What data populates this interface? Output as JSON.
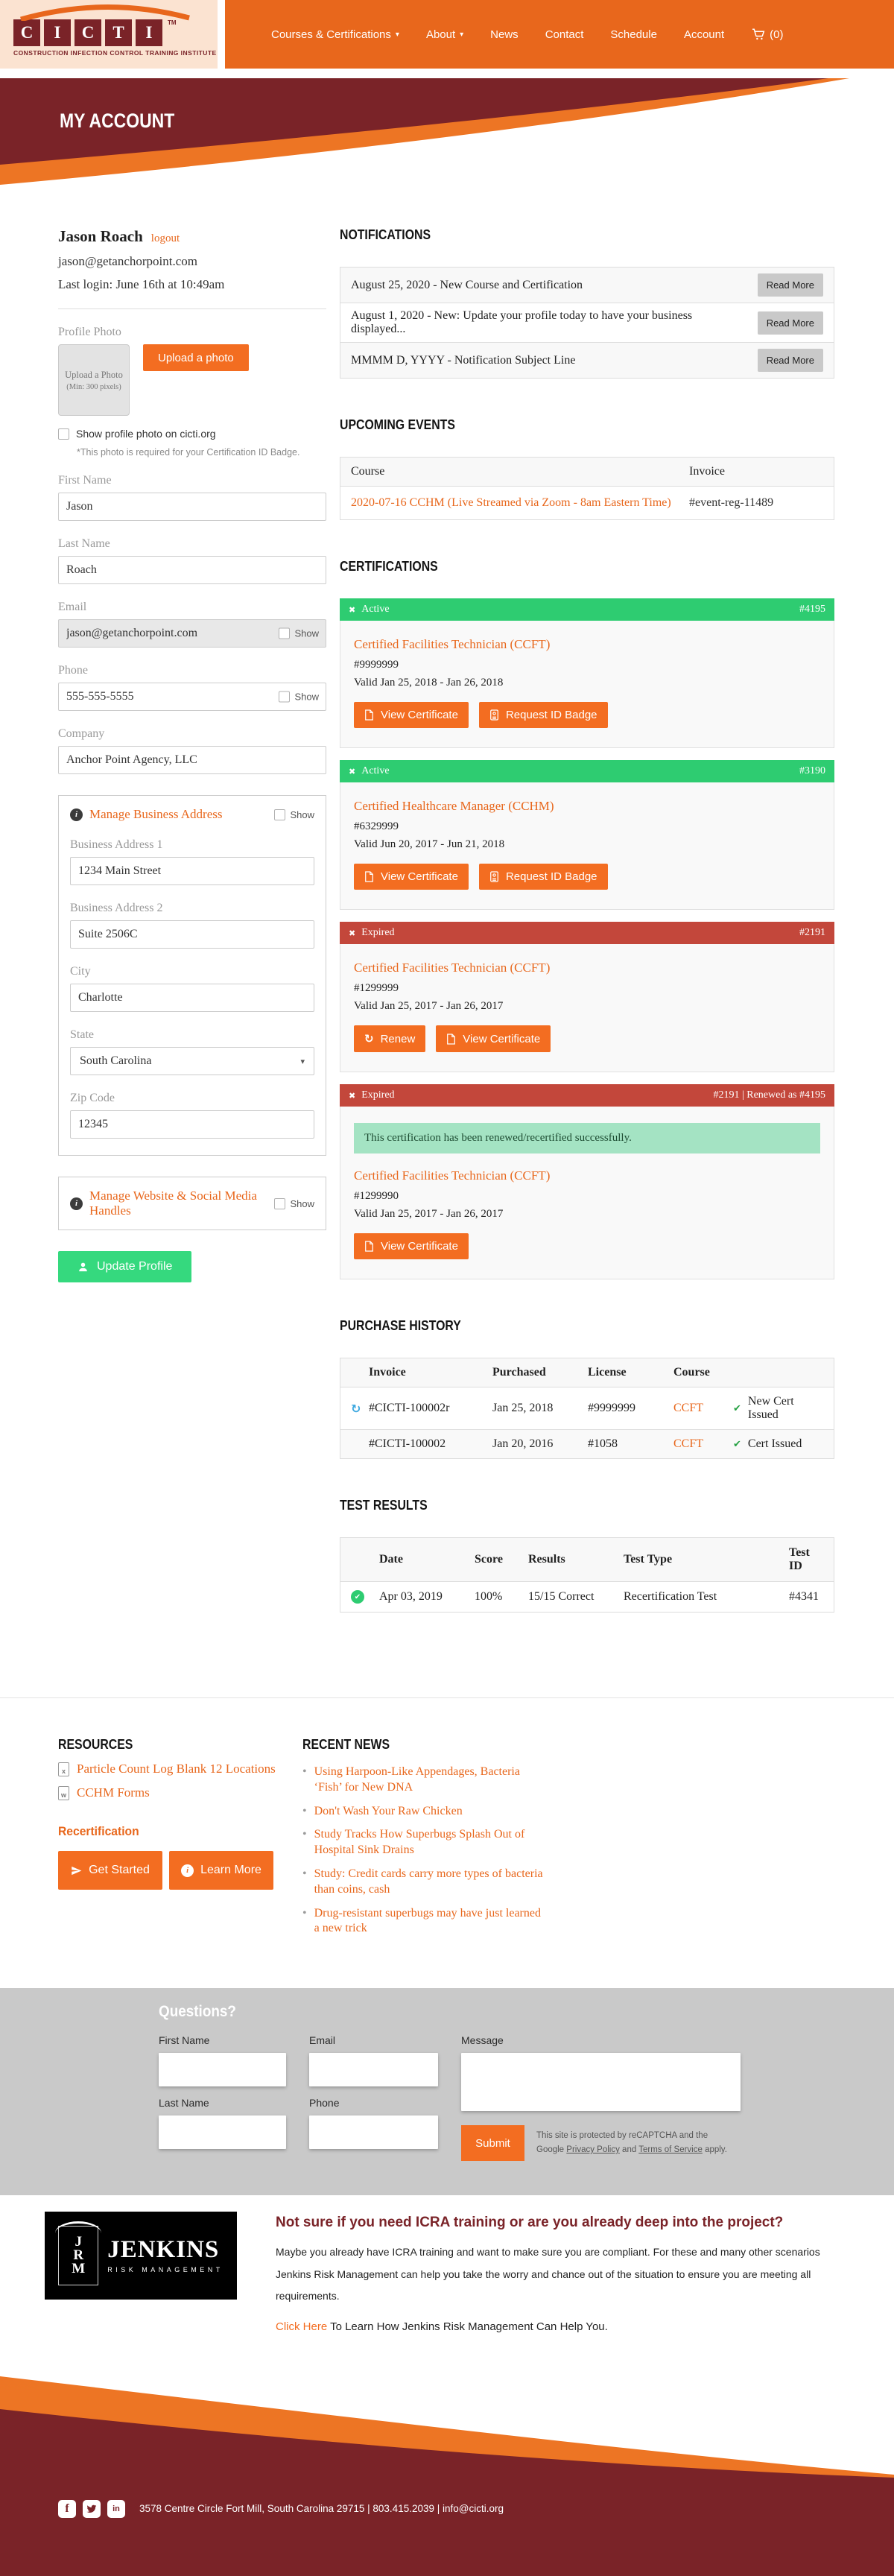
{
  "colors": {
    "orange": "#E8671C",
    "button_orange": "#F36D21",
    "maroon": "#7A2328",
    "green_active": "#2ECC71",
    "red_expired": "#C3473B",
    "update_green": "#35D97E",
    "gray_section": "#C9C9C9",
    "alert_green_bg": "#A4E3C3",
    "refresh_blue": "#3FA9E0"
  },
  "icons": {
    "chevron_down": "▾",
    "caret_down": "▾",
    "x_mark": "✖",
    "check": "✔",
    "refresh": "↻",
    "info": "i",
    "bullet": "•"
  },
  "header": {
    "logo": {
      "letters": [
        "C",
        "I",
        "C",
        "T",
        "I"
      ],
      "tm": "TM",
      "tagline": "CONSTRUCTION INFECTION CONTROL TRAINING INSTITUTE"
    },
    "nav": [
      {
        "label": "Courses & Certifications"
      },
      {
        "label": "About"
      },
      {
        "label": "News"
      },
      {
        "label": "Contact"
      },
      {
        "label": "Schedule"
      },
      {
        "label": "Account"
      },
      {
        "label": "(0)"
      }
    ]
  },
  "banner": {
    "title": "MY ACCOUNT"
  },
  "profile": {
    "name": "Jason Roach",
    "logout": "logout",
    "email": "jason@getanchorpoint.com",
    "last_login": "Last login: June 16th at 10:49am",
    "photo": {
      "label": "Profile Photo",
      "box_title": "Upload a Photo",
      "box_sub": "(Min: 300 pixels)",
      "upload_button": "Upload a photo",
      "show_label": "Show profile photo on cicti.org",
      "note": "*This photo is required for your Certification ID Badge."
    },
    "fields": {
      "first_name": {
        "label": "First Name",
        "value": "Jason"
      },
      "last_name": {
        "label": "Last Name",
        "value": "Roach"
      },
      "email": {
        "label": "Email",
        "value": "jason@getanchorpoint.com",
        "show": "Show"
      },
      "phone": {
        "label": "Phone",
        "value": "555-555-5555",
        "show": "Show"
      },
      "company": {
        "label": "Company",
        "value": "Anchor Point Agency, LLC"
      }
    },
    "business": {
      "title": "Manage Business Address",
      "show": "Show",
      "fields": {
        "address1": {
          "label": "Business Address 1",
          "value": "1234 Main Street"
        },
        "address2": {
          "label": "Business Address 2",
          "value": "Suite 2506C"
        },
        "city": {
          "label": "City",
          "value": "Charlotte"
        },
        "state": {
          "label": "State",
          "value": "South Carolina"
        },
        "zip": {
          "label": "Zip Code",
          "value": "12345"
        }
      }
    },
    "social_box": {
      "title": "Manage Website & Social Media Handles",
      "show": "Show"
    },
    "update_button": "Update Profile"
  },
  "notifications": {
    "heading": "NOTIFICATIONS",
    "read_more": "Read More",
    "items": [
      {
        "text": "August 25, 2020 - New Course and Certification"
      },
      {
        "text": "August 1, 2020 - New: Update your profile today to have your business displayed..."
      },
      {
        "text": "MMMM D, YYYY - Notification Subject Line"
      }
    ]
  },
  "events": {
    "heading": "UPCOMING EVENTS",
    "col_course": "Course",
    "col_invoice": "Invoice",
    "rows": [
      {
        "course": "2020-07-16 CCHM (Live Streamed via Zoom - 8am Eastern Time)",
        "invoice": "#event-reg-11489"
      }
    ]
  },
  "certifications": {
    "heading": "CERTIFICATIONS",
    "cards": [
      {
        "status": "Active",
        "ref": "#4195",
        "title": "Certified Facilities Technician (CCFT)",
        "number": "#9999999",
        "valid": "Valid Jan 25, 2018 - Jan 26, 2018",
        "btn1": "View Certificate",
        "btn2": "Request ID Badge"
      },
      {
        "status": "Active",
        "ref": "#3190",
        "title": "Certified Healthcare Manager (CCHM)",
        "number": "#6329999",
        "valid": "Valid Jun 20, 2017 - Jun 21, 2018",
        "btn1": "View Certificate",
        "btn2": "Request ID Badge"
      },
      {
        "status": "Expired",
        "ref": "#2191",
        "title": "Certified Facilities Technician (CCFT)",
        "number": "#1299999",
        "valid": "Valid Jan 25, 2017 - Jan 26, 2017",
        "btn1": "Renew",
        "btn2": "View Certificate"
      },
      {
        "status": "Expired",
        "ref": "#2191 | Renewed as #4195",
        "alert": "This certification has been renewed/recertified successfully.",
        "title": "Certified Facilities Technician (CCFT)",
        "number": "#1299990",
        "valid": "Valid Jan 25, 2017 - Jan 26, 2017",
        "btn1": "View Certificate"
      }
    ]
  },
  "purchase": {
    "heading": "PURCHASE HISTORY",
    "columns": {
      "invoice": "Invoice",
      "purchased": "Purchased",
      "license": "License",
      "course": "Course"
    },
    "rows": [
      {
        "invoice": "#CICTI-100002r",
        "purchased": "Jan 25, 2018",
        "license": "#9999999",
        "course": "CCFT",
        "status": "New Cert Issued"
      },
      {
        "invoice": "#CICTI-100002",
        "purchased": "Jan 20, 2016",
        "license": "#1058",
        "course": "CCFT",
        "status": "Cert Issued"
      }
    ]
  },
  "tests": {
    "heading": "TEST RESULTS",
    "columns": {
      "date": "Date",
      "score": "Score",
      "results": "Results",
      "type": "Test Type",
      "id": "Test ID"
    },
    "rows": [
      {
        "date": "Apr 03, 2019",
        "score": "100%",
        "results": "15/15 Correct",
        "type": "Recertification Test",
        "id": "#4341"
      }
    ]
  },
  "resources": {
    "heading": "RESOURCES",
    "links": [
      {
        "icon_letter": "x",
        "label": "Particle Count Log Blank 12 Locations"
      },
      {
        "icon_letter": "w",
        "label": "CCHM Forms"
      }
    ],
    "recert_heading": "Recertification",
    "get_started": "Get Started",
    "learn_more": "Learn More"
  },
  "news": {
    "heading": "RECENT NEWS",
    "items": [
      "Using Harpoon-Like Appendages, Bacteria ‘Fish’ for New DNA",
      "Don't Wash Your Raw Chicken",
      "Study Tracks How Superbugs Splash Out of Hospital Sink Drains",
      "Study: Credit cards carry more types of bacteria than coins, cash",
      "Drug-resistant superbugs may have just learned a new trick"
    ]
  },
  "questions": {
    "heading": "Questions?",
    "first_name": "First Name",
    "last_name": "Last Name",
    "email": "Email",
    "phone": "Phone",
    "message": "Message",
    "submit": "Submit",
    "recaptcha": {
      "line1": "This site is protected by reCAPTCHA and the",
      "line2_pre": "Google ",
      "privacy": "Privacy Policy",
      "mid": " and ",
      "terms": "Terms of Service",
      "post": " apply."
    }
  },
  "jenkins": {
    "logo": {
      "mono_letters": [
        "J",
        "R",
        "M"
      ],
      "name": "JENKINS",
      "sub": "RISK MANAGEMENT"
    },
    "heading": "Not sure if you need ICRA training or are you already deep into the project?",
    "body": "Maybe you already have ICRA training and want to make sure you are compliant. For these and many other scenarios Jenkins Risk Management can help you take the worry and chance out of the situation to ensure you are meeting all requirements.",
    "link": "Click Here",
    "link_rest": " To Learn How Jenkins Risk Management Can Help You."
  },
  "footer": {
    "facebook_glyph": "f",
    "linkedin_glyph": "in",
    "contact": "3578 Centre Circle Fort Mill, South Carolina 29715 | 803.415.2039 | info@cicti.org"
  }
}
